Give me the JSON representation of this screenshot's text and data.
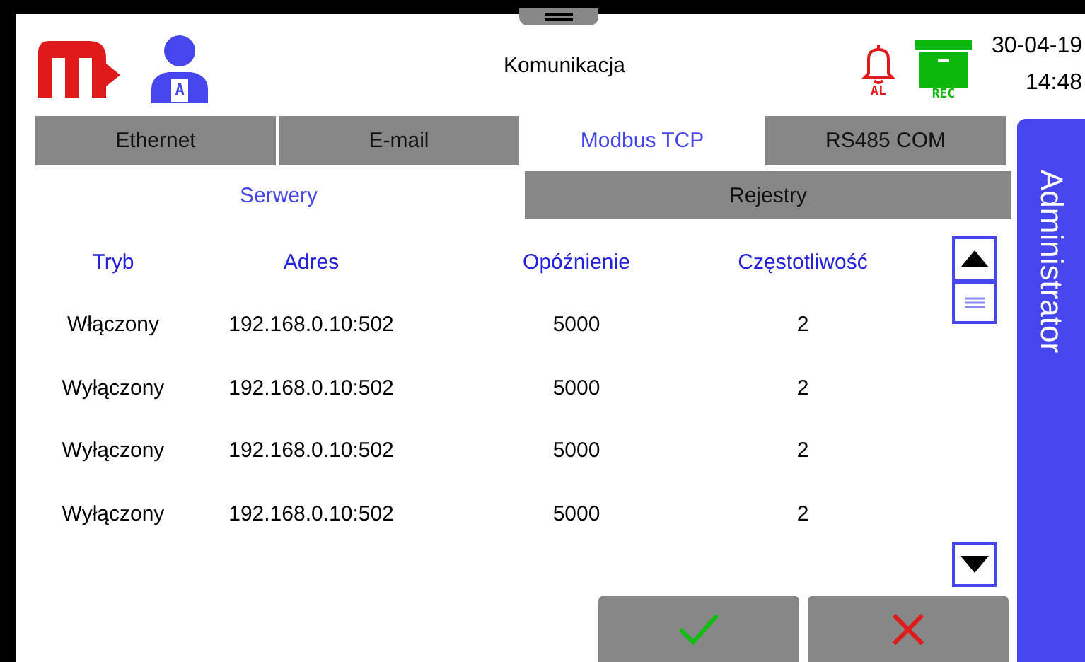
{
  "header": {
    "title": "Komunikacja",
    "date": "30-04-19",
    "time": "14:48",
    "user_badge": "A",
    "alarm_label": "AL",
    "record_label": "REC"
  },
  "tabs": [
    {
      "label": "Ethernet",
      "selected": false
    },
    {
      "label": "E-mail",
      "selected": false
    },
    {
      "label": "Modbus TCP",
      "selected": true
    },
    {
      "label": "RS485 COM",
      "selected": false
    }
  ],
  "subtabs": [
    {
      "label": "Serwery",
      "selected": true
    },
    {
      "label": "Rejestry",
      "selected": false
    }
  ],
  "table": {
    "columns": [
      "Tryb",
      "Adres",
      "Opóźnienie",
      "Częstotliwość"
    ],
    "rows": [
      [
        "Włączony",
        "192.168.0.10:502",
        "5000",
        "2"
      ],
      [
        "Wyłączony",
        "192.168.0.10:502",
        "5000",
        "2"
      ],
      [
        "Wyłączony",
        "192.168.0.10:502",
        "5000",
        "2"
      ],
      [
        "Wyłączony",
        "192.168.0.10:502",
        "5000",
        "2"
      ]
    ]
  },
  "side_panel": {
    "label": "Administrator"
  }
}
